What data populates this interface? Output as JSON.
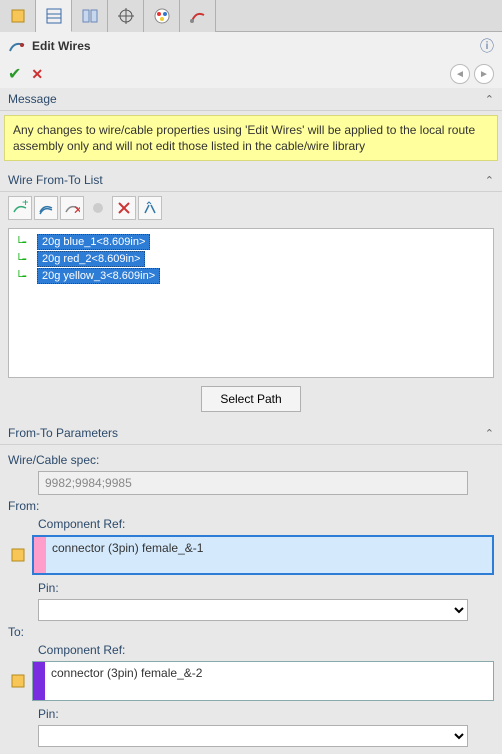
{
  "panel": {
    "title": "Edit Wires"
  },
  "sections": {
    "message_header": "Message",
    "message_body": "Any changes to wire/cable properties using 'Edit Wires' will be applied to the local route assembly only and will not edit those listed in the cable/wire library",
    "fromto_list_header": "Wire From-To List",
    "select_path_label": "Select Path",
    "fromto_params_header": "From-To Parameters",
    "spec_label": "Wire/Cable spec:",
    "spec_value": "9982;9984;9985",
    "from_label": "From:",
    "to_label": "To:",
    "comp_ref_label": "Component Ref:",
    "pin_label": "Pin:"
  },
  "wires": [
    {
      "label": "20g blue_1<8.609in>"
    },
    {
      "label": "20g red_2<8.609in>"
    },
    {
      "label": "20g yellow_3<8.609in>"
    }
  ],
  "from": {
    "component": "connector (3pin) female_&-1",
    "pin": ""
  },
  "to": {
    "component": "connector (3pin) female_&-2",
    "pin": ""
  }
}
